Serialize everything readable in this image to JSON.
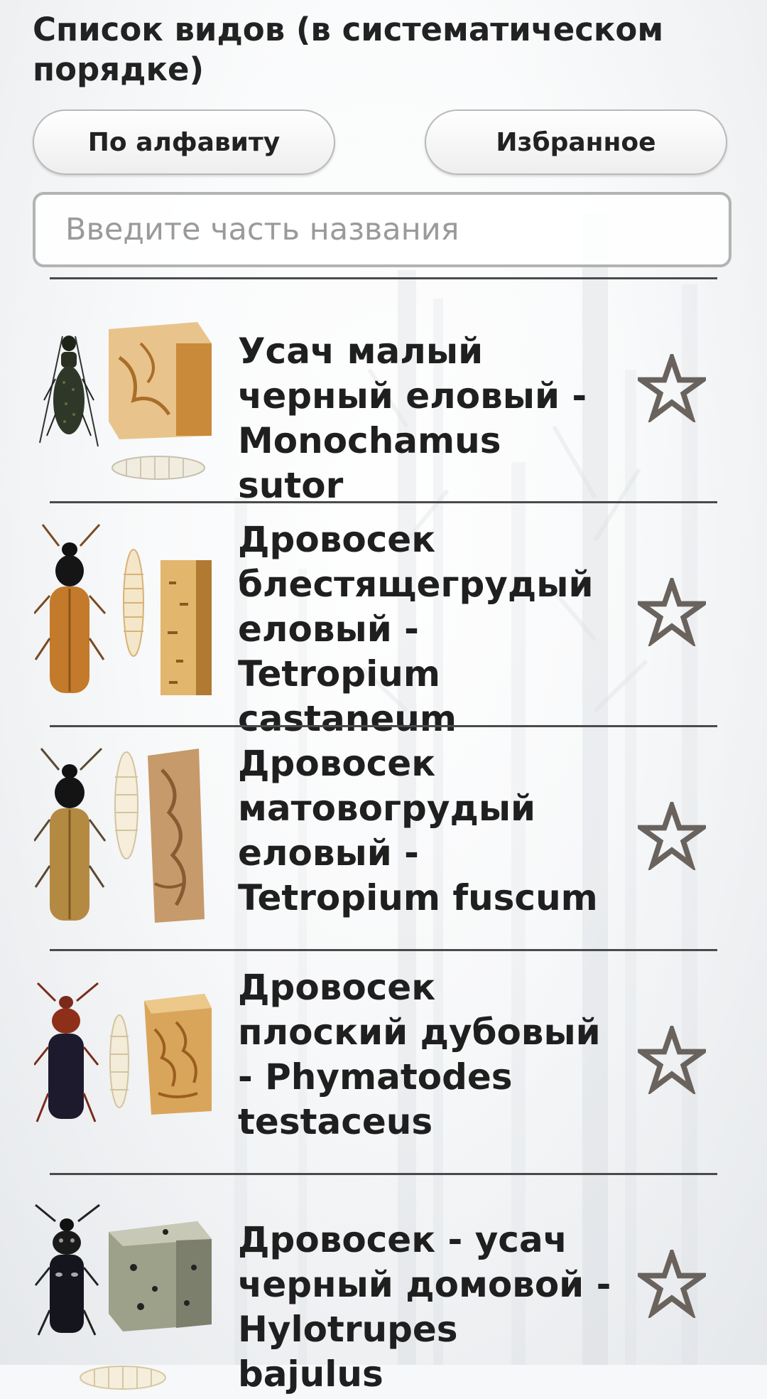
{
  "header": {
    "title": "Список видов (в систематическом порядке)"
  },
  "toolbar": {
    "alphabet_label": "По алфавиту",
    "favorites_label": "Избранное"
  },
  "search": {
    "placeholder": "Введите часть названия"
  },
  "species": [
    {
      "name": "Усач малый черный еловый - Monochamus sutor",
      "favorite": false
    },
    {
      "name": "Дровосек блестящегрудый еловый - Tetropium castaneum",
      "favorite": false
    },
    {
      "name": "Дровосек матовогрудый еловый - Tetropium fuscum",
      "favorite": false
    },
    {
      "name": "Дровосек плоский дубовый - Phymatodes testaceus",
      "favorite": false
    },
    {
      "name": "Дровосек - усач черный домовой - Hylotrupes bajulus",
      "favorite": false
    }
  ],
  "icons": {
    "favorite": "star-outline-icon"
  },
  "colors": {
    "text": "#222222",
    "star_stroke": "#6a625d",
    "divider": "#4a4a4a"
  }
}
